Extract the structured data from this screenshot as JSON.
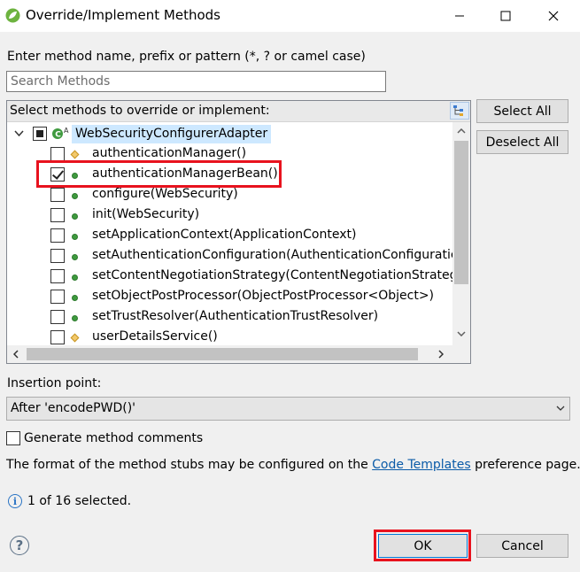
{
  "window": {
    "title": "Override/Implement Methods",
    "accent_color": "#0078d7",
    "highlight_color": "#e8121e"
  },
  "search": {
    "label": "Enter method name, prefix or pattern (*, ? or camel case)",
    "placeholder": "Search Methods",
    "value": ""
  },
  "tree": {
    "header": "Select methods to override or implement:",
    "root": {
      "label": "WebSecurityConfigurerAdapter",
      "state": "partial",
      "expanded": true
    },
    "items": [
      {
        "label": "authenticationManager()",
        "checked": false,
        "icon": "protected-diamond-icon"
      },
      {
        "label": "authenticationManagerBean()",
        "checked": true,
        "icon": "public-method-icon"
      },
      {
        "label": "configure(WebSecurity)",
        "checked": false,
        "icon": "public-method-icon"
      },
      {
        "label": "init(WebSecurity)",
        "checked": false,
        "icon": "public-method-icon"
      },
      {
        "label": "setApplicationContext(ApplicationContext)",
        "checked": false,
        "icon": "public-method-icon"
      },
      {
        "label": "setAuthenticationConfiguration(AuthenticationConfiguratic",
        "checked": false,
        "icon": "public-method-icon"
      },
      {
        "label": "setContentNegotiationStrategy(ContentNegotiationStrategy)",
        "checked": false,
        "icon": "public-method-icon"
      },
      {
        "label": "setObjectPostProcessor(ObjectPostProcessor<Object>)",
        "checked": false,
        "icon": "public-method-icon"
      },
      {
        "label": "setTrustResolver(AuthenticationTrustResolver)",
        "checked": false,
        "icon": "public-method-icon"
      },
      {
        "label": "userDetailsService()",
        "checked": false,
        "icon": "protected-diamond-icon"
      }
    ]
  },
  "buttons": {
    "select_all": "Select All",
    "deselect_all": "Deselect All",
    "ok": "OK",
    "cancel": "Cancel"
  },
  "insertion": {
    "label": "Insertion point:",
    "value": "After 'encodePWD()'"
  },
  "generate_comments": {
    "label": "Generate method comments",
    "checked": false
  },
  "format": {
    "before": "The format of the method stubs may be configured on the ",
    "link": "Code Templates",
    "after": " preference page."
  },
  "status": {
    "text": "1 of 16 selected."
  }
}
